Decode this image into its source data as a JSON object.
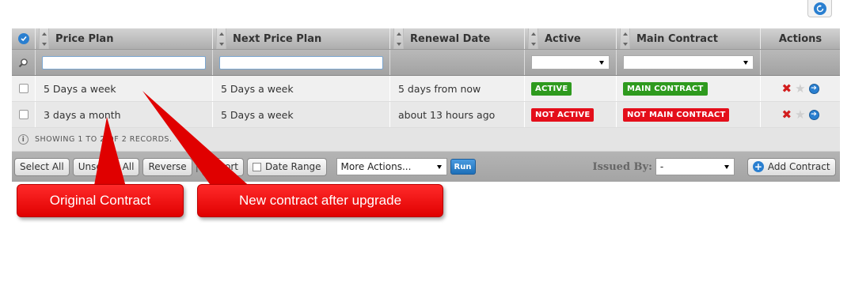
{
  "colors": {
    "accent_blue": "#2a7fd0",
    "active_green": "#2e9a1e",
    "inactive_red": "#e40e1a",
    "callout_red": "#ff1a1a"
  },
  "table": {
    "columns": [
      "Price Plan",
      "Next Price Plan",
      "Renewal Date",
      "Active",
      "Main Contract",
      "Actions"
    ],
    "rows": [
      {
        "price_plan": "5 Days a week",
        "next_price_plan": "5 Days a week",
        "renewal_date": "5 days from now",
        "active": "ACTIVE",
        "main_contract": "MAIN CONTRACT"
      },
      {
        "price_plan": "3 days a month",
        "next_price_plan": "5 Days a week",
        "renewal_date": "about 13 hours ago",
        "active": "NOT ACTIVE",
        "main_contract": "NOT MAIN CONTRACT"
      }
    ],
    "status_text": "SHOWING 1 TO 2 OF 2 RECORDS."
  },
  "toolbar": {
    "select_all": "Select All",
    "unselect_all": "Unselect All",
    "reverse": "Reverse",
    "export": "Export",
    "date_range": "Date Range",
    "more_actions": "More Actions...",
    "run": "Run",
    "issued_by_label": "Issued By:",
    "issued_by_value": "-",
    "add_contract": "Add Contract"
  },
  "annotations": {
    "original": "Original Contract",
    "new": "New contract after upgrade"
  }
}
